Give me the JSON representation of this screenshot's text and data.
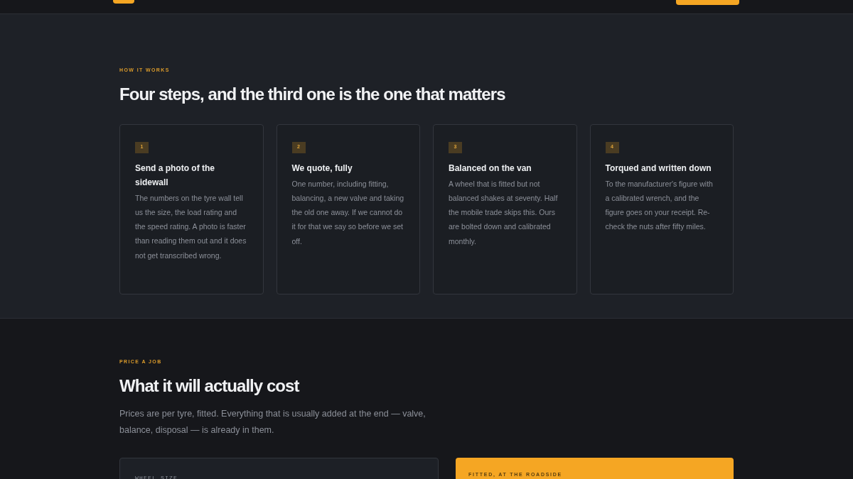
{
  "how_it_works": {
    "eyebrow": "HOW IT WORKS",
    "title": "Four steps, and the third one is the one that matters",
    "steps": [
      {
        "number": "1",
        "title": "Send a photo of the sidewall",
        "body": "The numbers on the tyre wall tell us the size, the load rating and the speed rating. A photo is faster than reading them out and it does not get transcribed wrong."
      },
      {
        "number": "2",
        "title": "We quote, fully",
        "body": "One number, including fitting, balancing, a new valve and taking the old one away. If we cannot do it for that we say so before we set off."
      },
      {
        "number": "3",
        "title": "Balanced on the van",
        "body": "A wheel that is fitted but not balanced shakes at seventy. Half the mobile trade skips this. Ours are bolted down and calibrated monthly."
      },
      {
        "number": "4",
        "title": "Torqued and written down",
        "body": "To the manufacturer's figure with a calibrated wrench, and the figure goes on your receipt. Re-check the nuts after fifty miles."
      }
    ]
  },
  "price": {
    "eyebrow": "PRICE A JOB",
    "title": "What it will actually cost",
    "intro": "Prices are per tyre, fitted. Everything that is usually added at the end — valve, balance, disposal — is already in them.",
    "form_label": "WHEEL SIZE",
    "result_label": "FITTED, AT THE ROADSIDE"
  }
}
